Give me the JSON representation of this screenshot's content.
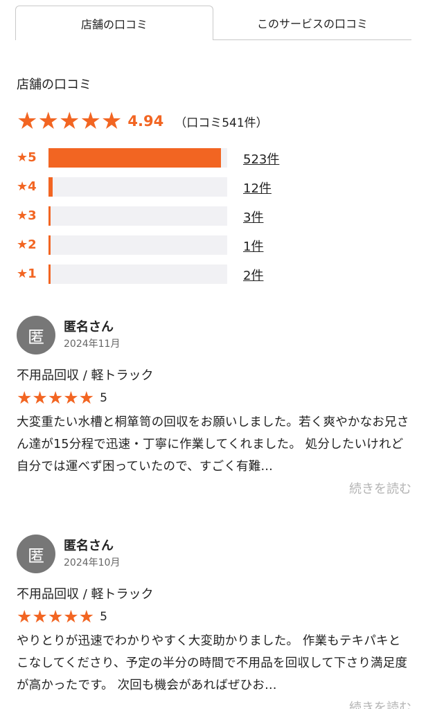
{
  "tabs": [
    {
      "label": "店舗の口コミ",
      "active": true
    },
    {
      "label": "このサービスの口コミ",
      "active": false
    }
  ],
  "section_title": "店舗の口コミ",
  "summary": {
    "stars": "★★★★★",
    "score": "4.94",
    "count_text": "（口コミ541件）"
  },
  "distribution": [
    {
      "label": "★5",
      "count_text": "523件",
      "fraction": 0.967
    },
    {
      "label": "★4",
      "count_text": "12件",
      "fraction": 0.022
    },
    {
      "label": "★3",
      "count_text": "3件",
      "fraction": 0.006
    },
    {
      "label": "★2",
      "count_text": "1件",
      "fraction": 0.002
    },
    {
      "label": "★1",
      "count_text": "2件",
      "fraction": 0.004
    }
  ],
  "reviews": [
    {
      "avatar_char": "匿",
      "name": "匿名さん",
      "date": "2024年11月",
      "service": "不用品回収 / 軽トラック",
      "stars": "★★★★★",
      "score": "5",
      "text": "大変重たい水槽と桐箪笥の回収をお願いしました。若く爽やかなお兄さん達が15分程で迅速・丁寧に作業してくれました。 処分したいけれど自分では運べず困っていたので、すごく有難…",
      "more": "続きを読む"
    },
    {
      "avatar_char": "匿",
      "name": "匿名さん",
      "date": "2024年10月",
      "service": "不用品回収 / 軽トラック",
      "stars": "★★★★★",
      "score": "5",
      "text": "やりとりが迅速でわかりやすく大変助かりました。 作業もテキパキとこなしてくださり、予定の半分の時間で不用品を回収して下さり満足度が高かったです。 次回も機会があればぜひお…",
      "more": "続きを読む"
    }
  ],
  "colors": {
    "accent": "#f26522",
    "track": "#f1f1f4",
    "avatar": "#777777",
    "muted": "#b4b4b4"
  }
}
